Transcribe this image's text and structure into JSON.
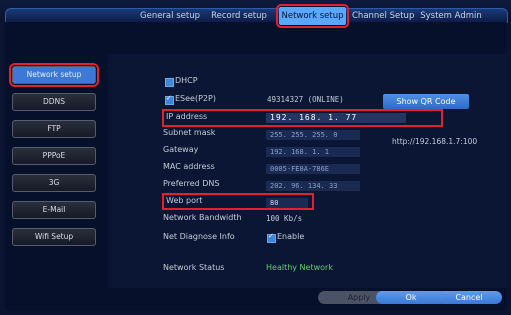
{
  "tabs": [
    {
      "label": "General setup"
    },
    {
      "label": "Record setup"
    },
    {
      "label": "Network setup"
    },
    {
      "label": "Channel Setup"
    },
    {
      "label": "System Admin"
    }
  ],
  "sidebar": {
    "items": [
      {
        "label": "Network setup"
      },
      {
        "label": "DDNS"
      },
      {
        "label": "FTP"
      },
      {
        "label": "PPPoE"
      },
      {
        "label": "3G"
      },
      {
        "label": "E-Mail"
      },
      {
        "label": "Wifi Setup"
      }
    ]
  },
  "network": {
    "dhcp_label": "DHCP",
    "esee_label": "ESee(P2P)",
    "esee_value": "49314327   (ONLINE)",
    "show_qr_label": "Show QR Code",
    "ip_label": "IP address",
    "ip_value": "192.  168.   1.  77",
    "url_value": "http://192.168.1.7:100",
    "subnet_label": "Subnet mask",
    "subnet_value": "255. 255. 255.   0",
    "gateway_label": "Gateway",
    "gateway_value": "192. 168.   1.   1",
    "mac_label": "MAC address",
    "mac_value": "0005-FE8A-786E",
    "dns_label": "Preferred DNS",
    "dns_value": "202.  96. 134.  33",
    "webport_label": "Web port",
    "webport_value": "80",
    "bandwidth_label": "Network Bandwidth",
    "bandwidth_value": "100   Kb/s",
    "diag_label": "Net Diagnose Info",
    "diag_enable_label": "Enable",
    "status_label": "Network Status",
    "status_value": "Healthy Network"
  },
  "footer": {
    "apply_label": "Apply",
    "ok_label": "Ok",
    "cancel_label": "Cancel"
  },
  "colors": {
    "background": "#0a1430",
    "accent": "#3d78d8",
    "highlight": "#e2222b",
    "status_ok": "#5fd16b"
  }
}
